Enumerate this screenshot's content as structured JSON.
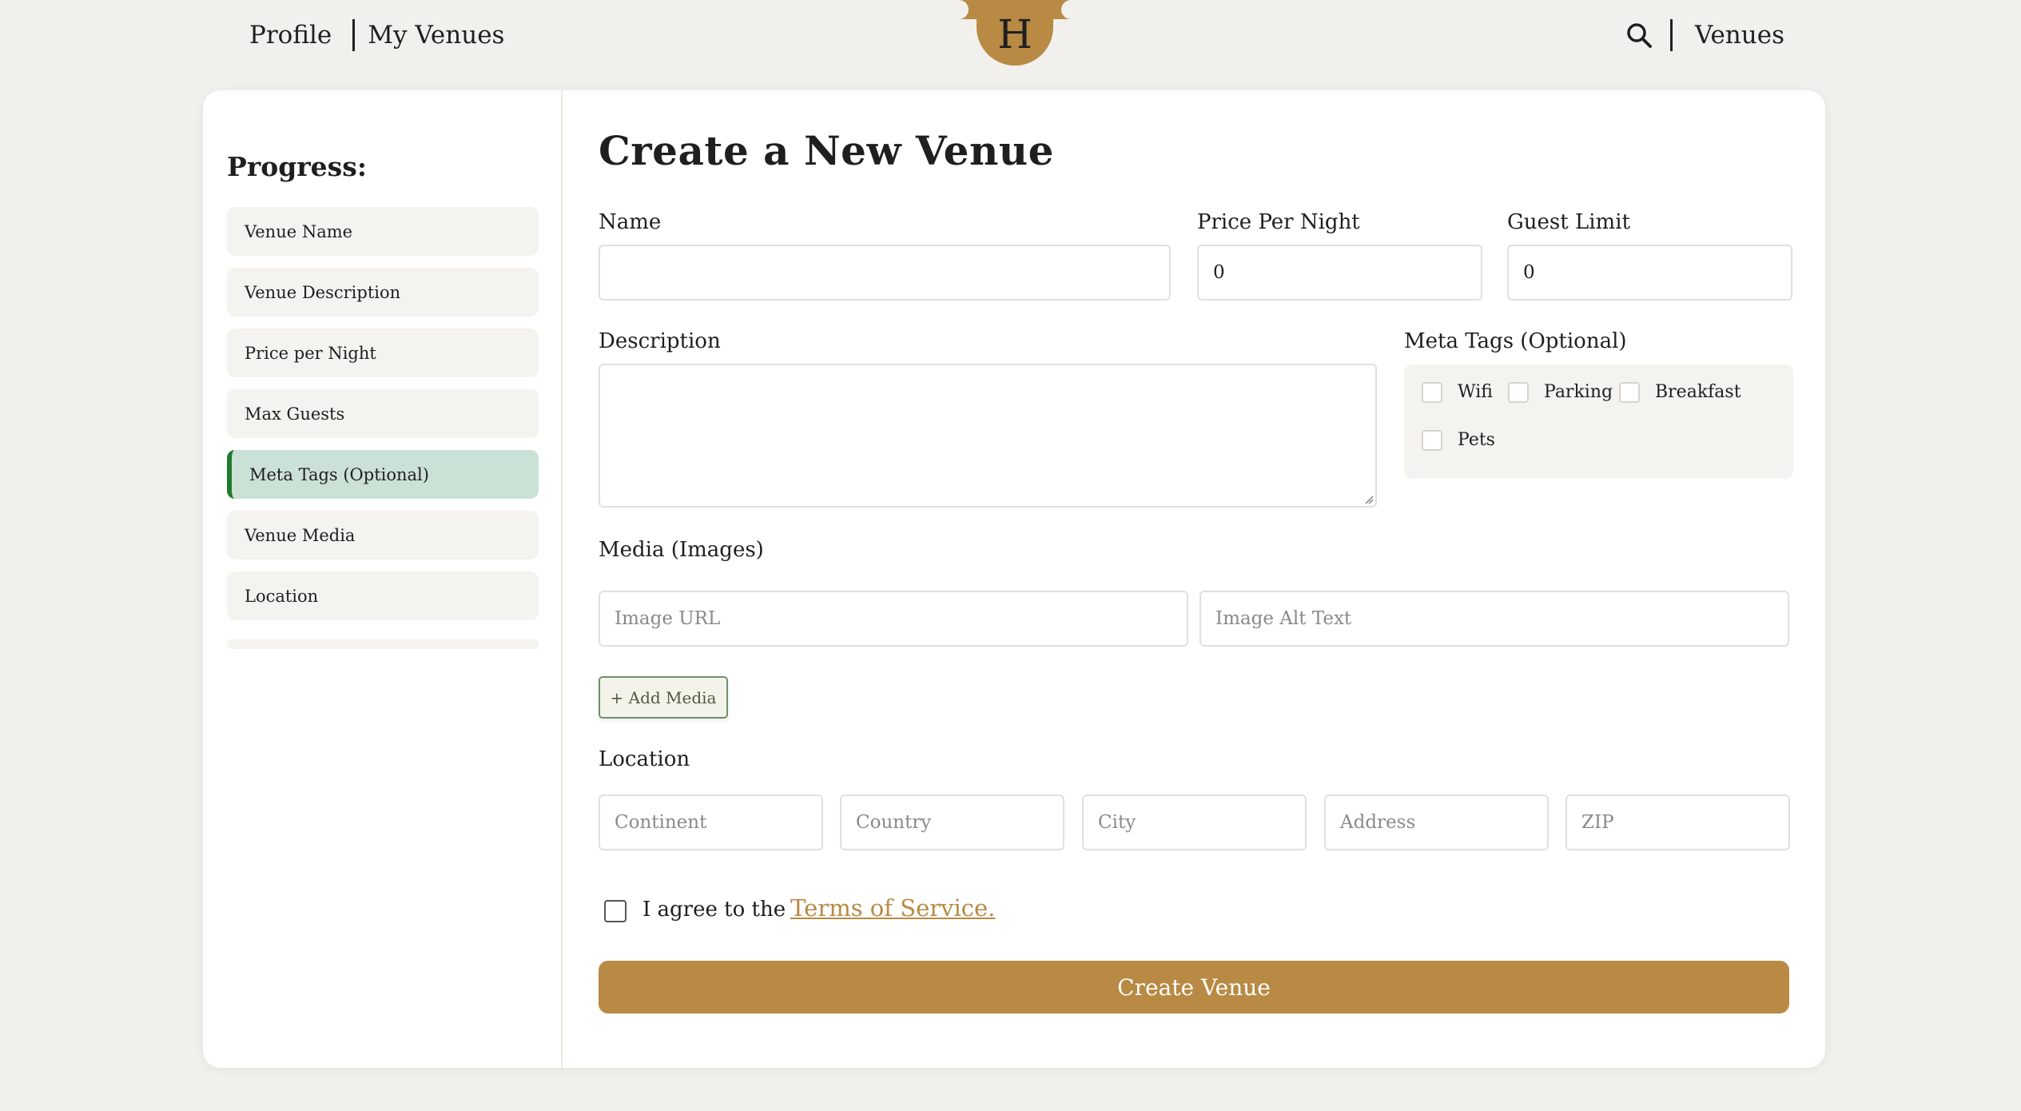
{
  "header": {
    "nav_left": [
      "Profile",
      "My Venues"
    ],
    "logo_letter": "H",
    "nav_right_link": "Venues",
    "search_icon": "search-icon"
  },
  "sidebar": {
    "title": "Progress:",
    "steps": [
      {
        "label": "Venue Name",
        "active": false
      },
      {
        "label": "Venue Description",
        "active": false
      },
      {
        "label": "Price per Night",
        "active": false
      },
      {
        "label": "Max Guests",
        "active": false
      },
      {
        "label": "Meta Tags (Optional)",
        "active": true
      },
      {
        "label": "Venue Media",
        "active": false
      },
      {
        "label": "Location",
        "active": false
      }
    ]
  },
  "form": {
    "title": "Create a New Venue",
    "name_label": "Name",
    "name_value": "",
    "price_label": "Price Per Night",
    "price_value": "0",
    "guests_label": "Guest Limit",
    "guests_value": "0",
    "description_label": "Description",
    "description_value": "",
    "meta_label": "Meta Tags (Optional)",
    "meta_options": [
      "Wifi",
      "Parking",
      "Breakfast",
      "Pets"
    ],
    "media_label": "Media (Images)",
    "image_url_placeholder": "Image URL",
    "image_alt_placeholder": "Image Alt Text",
    "add_media_label": "+ Add Media",
    "location_label": "Location",
    "location_placeholders": [
      "Continent",
      "Country",
      "City",
      "Address",
      "ZIP"
    ],
    "agree_text": "I agree to the",
    "tos_text": "Terms of Service.",
    "submit_label": "Create Venue"
  },
  "colors": {
    "accent": "#b88a44",
    "active_step_bg": "#cce1d5",
    "active_step_border": "#1e7b2c",
    "background": "#f2f0ec"
  }
}
